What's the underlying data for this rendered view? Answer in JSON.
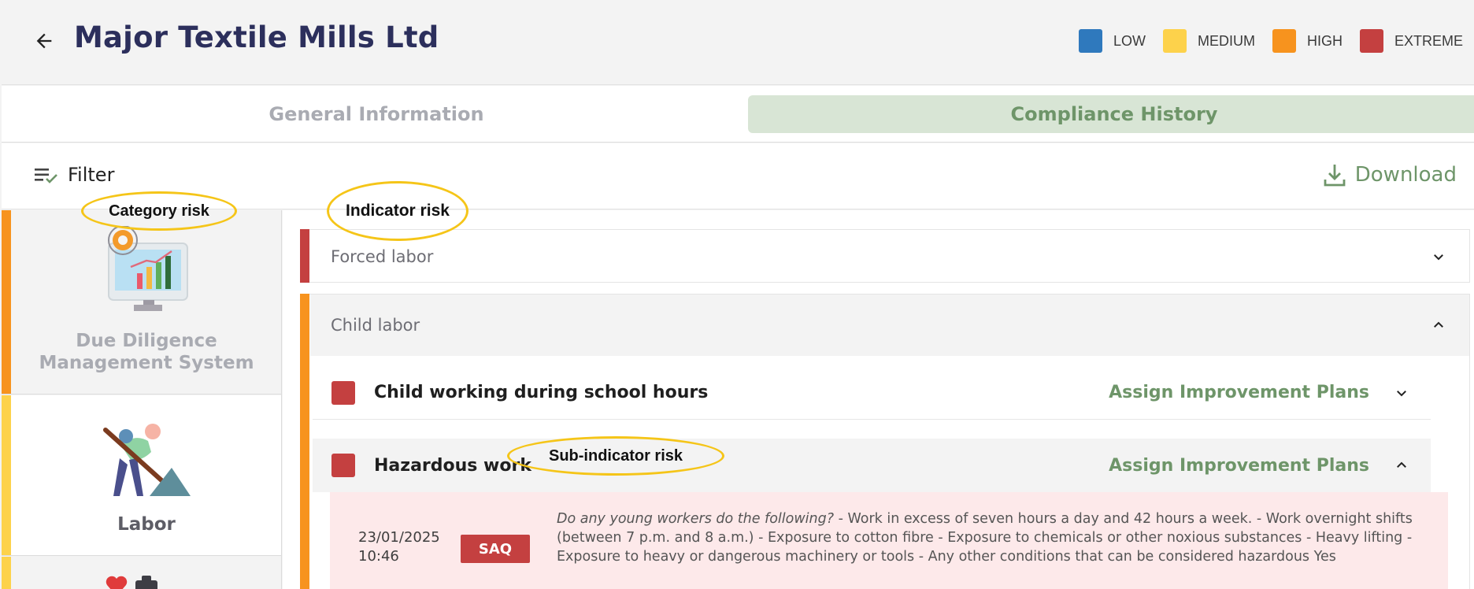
{
  "header": {
    "title": "Major Textile Mills Ltd",
    "legend": [
      {
        "label": "LOW",
        "color": "#2f79bd"
      },
      {
        "label": "MEDIUM",
        "color": "#fdd24b"
      },
      {
        "label": "HIGH",
        "color": "#f7931e"
      },
      {
        "label": "EXTREME",
        "color": "#c44040"
      }
    ]
  },
  "tabs": [
    {
      "label": "General Information",
      "active": false
    },
    {
      "label": "Compliance History",
      "active": true
    }
  ],
  "toolbar": {
    "filter_label": "Filter",
    "download_label": "Download"
  },
  "categories": [
    {
      "label_line1": "Due Diligence",
      "label_line2": "Management System",
      "risk_color": "#f7931e",
      "icon": "chart-monitor-icon"
    },
    {
      "label_line1": "Labor",
      "risk_color": "#fdd24b",
      "icon": "worker-shovel-icon"
    },
    {
      "risk_color": "#fdd24b",
      "icon": "health-icon"
    }
  ],
  "indicators": [
    {
      "title": "Forced labor",
      "risk_color": "#c44040",
      "expanded": false
    },
    {
      "title": "Child labor",
      "risk_color": "#f7931e",
      "expanded": true
    }
  ],
  "sub_indicators": [
    {
      "title": "Child working during school hours",
      "action": "Assign Improvement Plans",
      "risk_color": "#c44040",
      "expanded": false
    },
    {
      "title": "Hazardous work",
      "action": "Assign Improvement Plans",
      "risk_color": "#c44040",
      "expanded": true
    }
  ],
  "detail": {
    "date": "23/01/2025",
    "time": "10:46",
    "badge": "SAQ",
    "question": "Do any young workers do the following?",
    "answer": " - Work in excess of seven hours a day and 42 hours a week. - Work overnight shifts (between 7 p.m. and 8 a.m.) - Exposure to cotton fibre - Exposure to chemicals or other noxious substances - Heavy lifting - Exposure to heavy or dangerous machinery or tools - Any other conditions that can be considered hazardous Yes"
  },
  "annotations": {
    "category": "Category risk",
    "indicator": "Indicator risk",
    "sub_indicator": "Sub-indicator risk"
  }
}
